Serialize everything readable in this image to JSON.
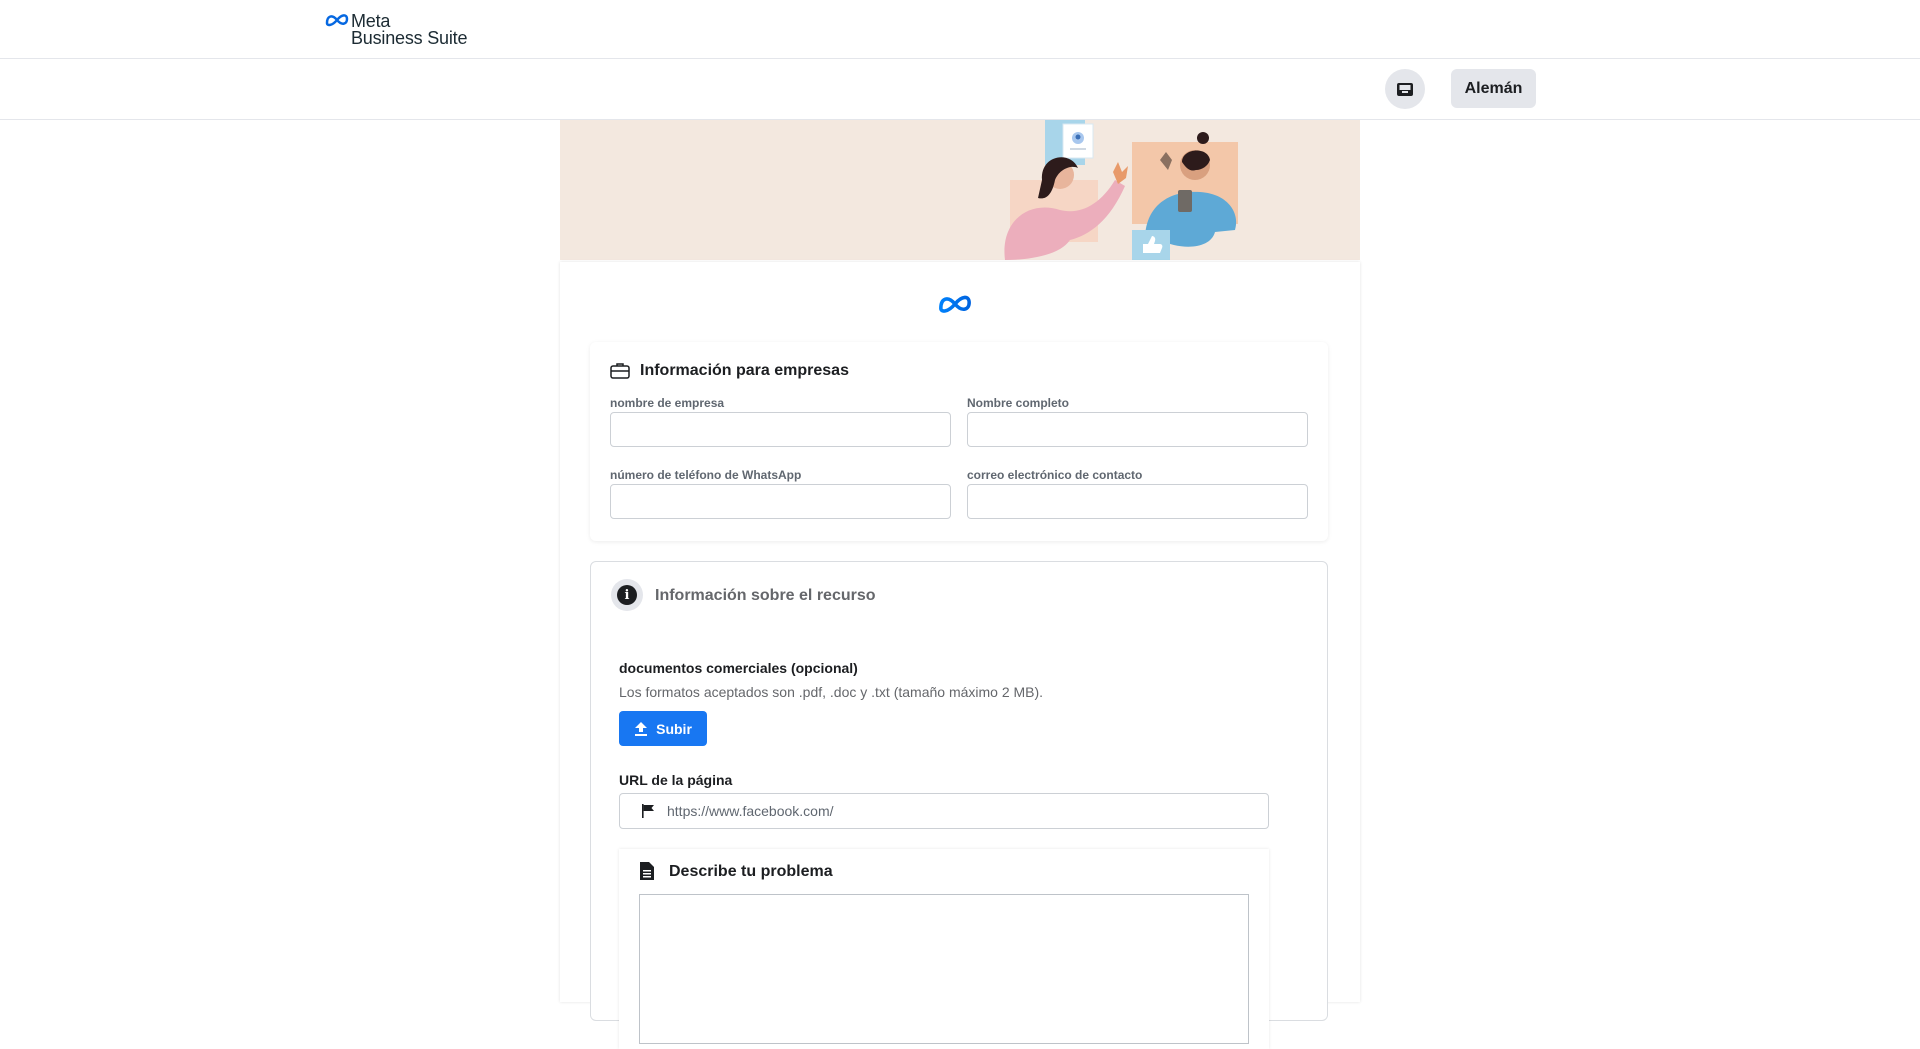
{
  "header": {
    "brand_line1": "Meta",
    "brand_line2": "Business Suite"
  },
  "subbar": {
    "inbox_icon": "inbox-icon",
    "language_label": "Alemán"
  },
  "business_info": {
    "title": "Información para empresas",
    "fields": {
      "company_name_label": "nombre de empresa",
      "full_name_label": "Nombre completo",
      "whatsapp_label": "número de teléfono de WhatsApp",
      "email_label": "correo electrónico de contacto"
    }
  },
  "resource_info": {
    "title": "Información sobre el recurso",
    "documents_label": "documentos comerciales (opcional)",
    "documents_help": "Los formatos aceptados son .pdf, .doc y .txt (tamaño máximo 2 MB).",
    "upload_label": "Subir",
    "url_label": "URL de la página",
    "url_placeholder": "https://www.facebook.com/",
    "describe_title": "Describe tu problema"
  },
  "colors": {
    "primary": "#1877f2",
    "hero_bg": "#f3e8df",
    "meta_blue": "#0668e1"
  }
}
